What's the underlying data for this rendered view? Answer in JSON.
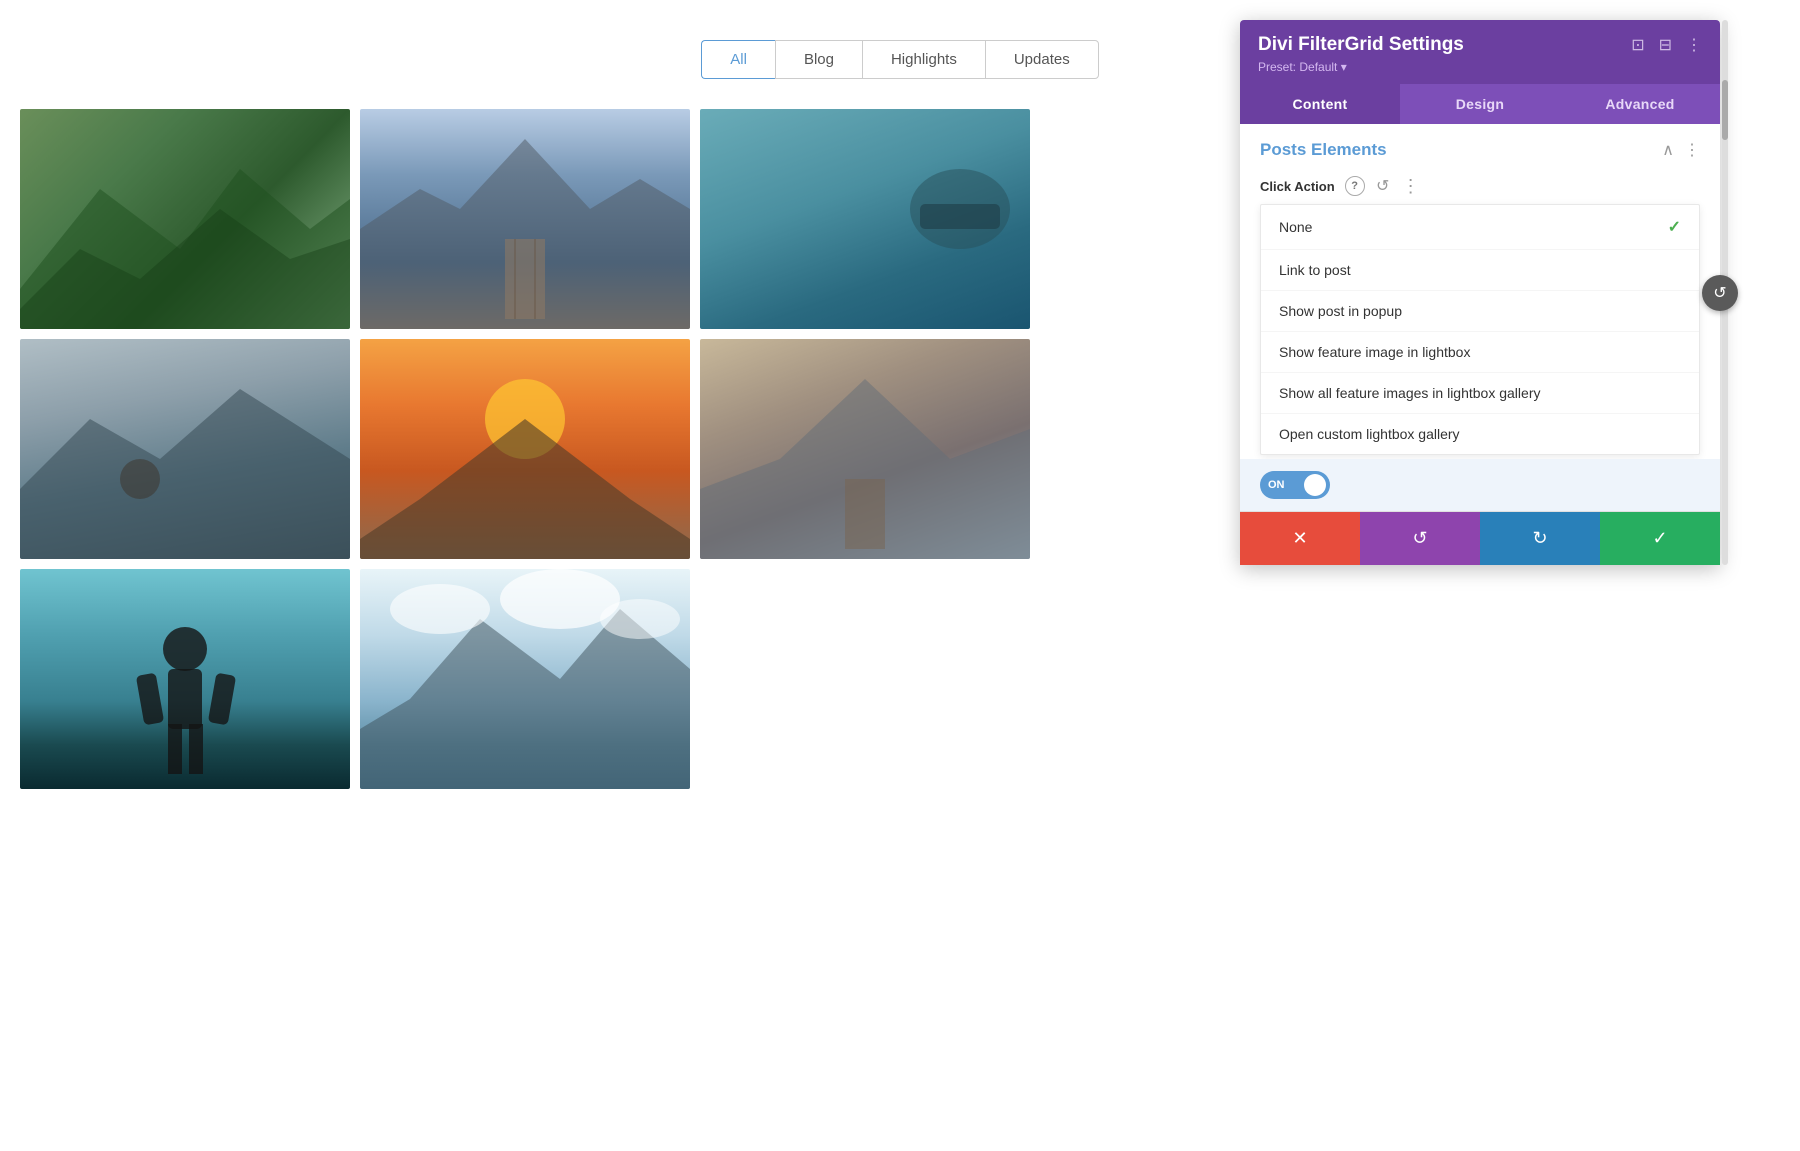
{
  "filterTabs": {
    "tabs": [
      {
        "id": "all",
        "label": "All",
        "active": true
      },
      {
        "id": "blog",
        "label": "Blog",
        "active": false
      },
      {
        "id": "highlights",
        "label": "Highlights",
        "active": false
      },
      {
        "id": "updates",
        "label": "Updates",
        "active": false
      }
    ]
  },
  "panel": {
    "title": "Divi FilterGrid Settings",
    "preset_label": "Preset: Default ▾",
    "tabs": [
      {
        "id": "content",
        "label": "Content",
        "active": true
      },
      {
        "id": "design",
        "label": "Design",
        "active": false
      },
      {
        "id": "advanced",
        "label": "Advanced",
        "active": false
      }
    ],
    "section_title": "Posts Elements",
    "click_action_label": "Click Action",
    "dropdown_options": [
      {
        "label": "None",
        "selected": true
      },
      {
        "label": "Link to post",
        "selected": false
      },
      {
        "label": "Show post in popup",
        "selected": false
      },
      {
        "label": "Show feature image in lightbox",
        "selected": false
      },
      {
        "label": "Show all feature images in lightbox gallery",
        "selected": false
      },
      {
        "label": "Open custom lightbox gallery",
        "selected": false
      }
    ],
    "toggle_label": "ON",
    "actions": {
      "cancel": "✕",
      "undo": "↺",
      "redo": "↻",
      "save": "✓"
    }
  }
}
